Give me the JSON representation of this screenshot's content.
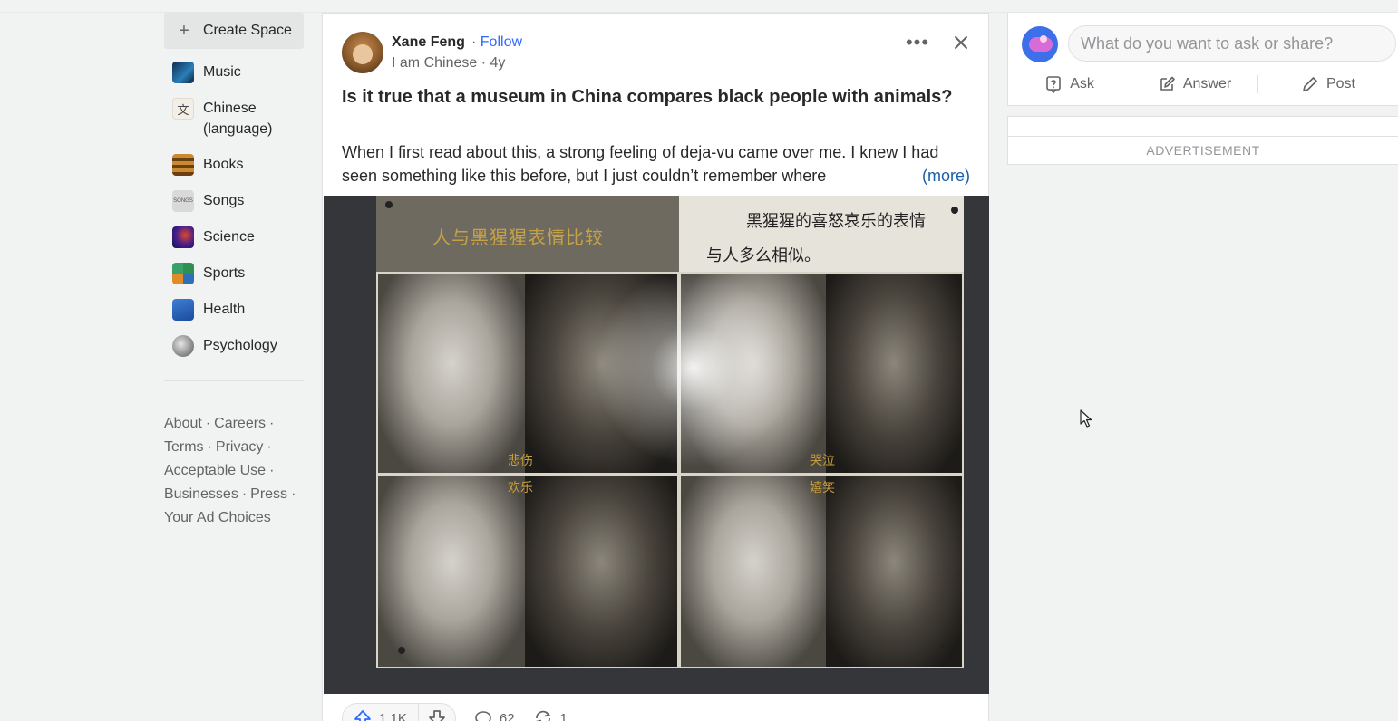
{
  "sidebar": {
    "create_space": "Create Space",
    "items": [
      {
        "label": "Music",
        "icon": "music-topic-icon",
        "color": "#1f4e79"
      },
      {
        "label": "Chinese (language)",
        "icon": "chinese-language-topic-icon",
        "color": "#f3efe6"
      },
      {
        "label": "Books",
        "icon": "books-topic-icon",
        "color": "#8b5a1d"
      },
      {
        "label": "Songs",
        "icon": "songs-topic-icon",
        "color": "#d9d9d9"
      },
      {
        "label": "Science",
        "icon": "science-topic-icon",
        "color": "#2a2a7a"
      },
      {
        "label": "Sports",
        "icon": "sports-topic-icon",
        "color": "#3b8f5a"
      },
      {
        "label": "Health",
        "icon": "health-topic-icon",
        "color": "#2d5fa8"
      },
      {
        "label": "Psychology",
        "icon": "psychology-topic-icon",
        "color": "#9a9a9a"
      }
    ],
    "footer": {
      "about": "About",
      "careers": "Careers",
      "terms": "Terms",
      "privacy": "Privacy",
      "acceptable_use": "Acceptable Use",
      "businesses": "Businesses",
      "press": "Press",
      "ad_choices": "Your Ad Choices",
      "sep": "·"
    }
  },
  "post": {
    "author": "Xane Feng",
    "follow_sep": "·",
    "follow": "Follow",
    "credential": "I am Chinese · 4y",
    "title": "Is it true that a museum in China compares black people with animals?",
    "excerpt": "When I first read about this, a strong feeling of deja-vu came over me. I knew I had seen something like this before, but I just couldn’t remember where",
    "more": "(more)",
    "image": {
      "header_left": "人与黑猩猩表情比较",
      "header_right_line1": "黑猩猩的喜怒哀乐的表情",
      "header_right_line2": "与人多么相似。",
      "tag1": "悲伤",
      "tag2": "哭泣",
      "tag3": "欢乐",
      "tag4": "嬉笑"
    },
    "upvotes": "1.1K",
    "comments": "62",
    "shares": "1"
  },
  "right": {
    "ask_placeholder": "What do you want to ask or share?",
    "ask": "Ask",
    "answer": "Answer",
    "post": "Post",
    "ad_label": "ADVERTISEMENT"
  },
  "colors": {
    "link_blue": "#2e69ff",
    "more_blue": "#195faa",
    "text": "#282829",
    "muted": "#636466"
  }
}
